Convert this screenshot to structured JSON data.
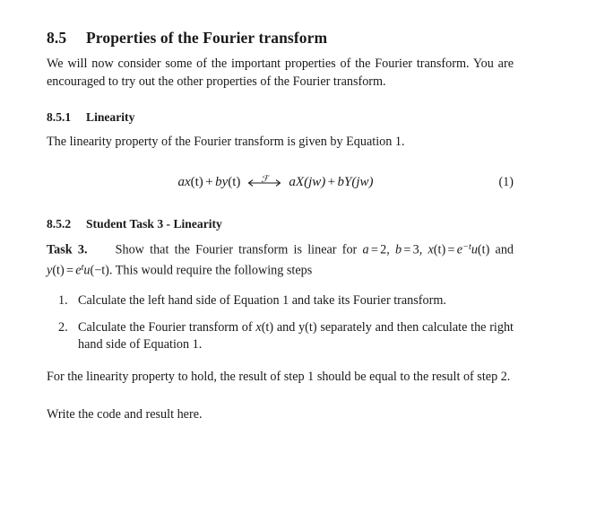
{
  "document": {
    "section": {
      "number": "8.5",
      "title": "Properties of the Fourier transform"
    },
    "intro_paragraph": "We will now consider some of the important properties of the Fourier transform. You are encouraged to try out the other properties of the Fourier transform.",
    "subsections": [
      {
        "number": "8.5.1",
        "title": "Linearity",
        "paragraph": "The linearity property of the Fourier transform is given by Equation 1."
      },
      {
        "number": "8.5.2",
        "title": "Student Task 3 - Linearity"
      }
    ],
    "equation": {
      "number": "(1)",
      "lhs_a": "a",
      "lhs_x": "x",
      "lhs_t1": "(t)",
      "plus1": "+",
      "lhs_b": "b",
      "lhs_y": "y",
      "lhs_t2": "(t)",
      "transform_symbol": "ℱ",
      "rhs_a": "a",
      "rhs_X": "X",
      "rhs_jw1": "(jw)",
      "plus2": "+",
      "rhs_b": "b",
      "rhs_Y": "Y",
      "rhs_jw2": "(jw)",
      "plain_text": "ax(t) + by(t) <--F--> aX(jw) + bY(jw)"
    },
    "task": {
      "label": "Task 3.",
      "text_part1": "Show that the Fourier transform is linear for ",
      "a_var": "a",
      "equals1": "=",
      "a_value": "2",
      "comma1": ",",
      "b_var": "b",
      "equals2": "=",
      "b_value": "3",
      "comma2": ",",
      "x_var": "x",
      "x_arg": "(t)",
      "equals3": "=",
      "e_base": "e",
      "x_exponent": "−t",
      "u_func": "u",
      "u_arg_x": "(t)",
      "and_word": "and",
      "y_var": "y",
      "y_arg": "(t)",
      "equals4": "=",
      "y_exponent": "t",
      "u_arg_y": "(−t)",
      "period": ".",
      "text_part2": "This would require the following steps",
      "plain_text": "Task 3. Show that the Fourier transform is linear for a = 2, b = 3, x(t) = e^{-t}u(t) and y(t) = e^{t}u(-t). This would require the following steps"
    },
    "steps": [
      {
        "marker": "1.",
        "text": "Calculate the left hand side of Equation 1 and take its Fourier transform."
      },
      {
        "marker": "2.",
        "text_before_x": "Calculate the Fourier transform of ",
        "x_var": "x",
        "x_arg": "(t)",
        "text_middle": " and y(t) separately and then calculate the right hand side of Equation 1.",
        "plain_text": "Calculate the Fourier transform of x(t) and y(t) separately and then calculate the right hand side of Equation 1."
      }
    ],
    "closing_paragraph": "For the linearity property to hold, the result of step 1 should be equal to the result of step 2.",
    "final_prompt": "Write the code and result here."
  }
}
